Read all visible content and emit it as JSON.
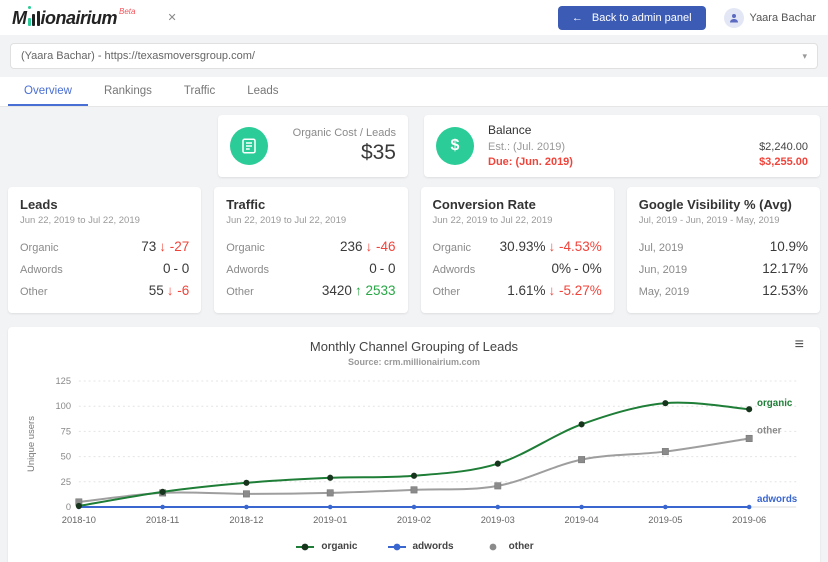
{
  "colors": {
    "accent_blue": "#3b5bb5",
    "tab_active_blue": "#4a6fd4",
    "icon_green": "#2bcc97",
    "negative_red": "#f0443b",
    "positive_green": "#28a745",
    "beta_red": "#f2545b"
  },
  "header": {
    "logo_prefix": "M",
    "logo_suffix": "ionairium",
    "logo_beta": "Beta",
    "back_button_label": "Back to admin panel",
    "user_name": "Yaara Bachar"
  },
  "icons": {
    "collapse": "✕",
    "back_arrow": "←",
    "caret_down": "▾",
    "menu": "≡",
    "dollar": "$"
  },
  "site_selector": {
    "value": "(Yaara Bachar) - https://texasmoversgroup.com/"
  },
  "tabs": [
    {
      "label": "Overview",
      "active": true
    },
    {
      "label": "Rankings",
      "active": false
    },
    {
      "label": "Traffic",
      "active": false
    },
    {
      "label": "Leads",
      "active": false
    }
  ],
  "summary": {
    "organic_cost": {
      "label": "Organic Cost / Leads",
      "value": "$35"
    },
    "balance": {
      "title": "Balance",
      "rows": [
        {
          "label": "Est.: (Jul. 2019)",
          "value": "$2,240.00",
          "color": "default"
        },
        {
          "label": "Due: (Jun. 2019)",
          "value": "$3,255.00",
          "color": "red"
        }
      ]
    }
  },
  "stat_cards": [
    {
      "title": "Leads",
      "subtitle": "Jun 22, 2019 to Jul 22, 2019",
      "rows": [
        {
          "label": "Organic",
          "value": "73",
          "delta": "↓ -27",
          "delta_color": "red"
        },
        {
          "label": "Adwords",
          "value": "0",
          "delta": "- 0",
          "delta_color": "neutral"
        },
        {
          "label": "Other",
          "value": "55",
          "delta": "↓ -6",
          "delta_color": "red"
        }
      ]
    },
    {
      "title": "Traffic",
      "subtitle": "Jun 22, 2019 to Jul 22, 2019",
      "rows": [
        {
          "label": "Organic",
          "value": "236",
          "delta": "↓ -46",
          "delta_color": "red"
        },
        {
          "label": "Adwords",
          "value": "0",
          "delta": "- 0",
          "delta_color": "neutral"
        },
        {
          "label": "Other",
          "value": "3420",
          "delta": "↑ 2533",
          "delta_color": "green"
        }
      ]
    },
    {
      "title": "Conversion Rate",
      "subtitle": "Jun 22, 2019 to Jul 22, 2019",
      "rows": [
        {
          "label": "Organic",
          "value": "30.93%",
          "delta": "↓ -4.53%",
          "delta_color": "red"
        },
        {
          "label": "Adwords",
          "value": "0%",
          "delta": "- 0%",
          "delta_color": "neutral"
        },
        {
          "label": "Other",
          "value": "1.61%",
          "delta": "↓ -5.27%",
          "delta_color": "red"
        }
      ]
    },
    {
      "title": "Google Visibility % (Avg)",
      "subtitle": "Jul, 2019 - Jun, 2019 - May, 2019",
      "rows": [
        {
          "label": "Jul, 2019",
          "value": "10.9%"
        },
        {
          "label": "Jun, 2019",
          "value": "12.17%"
        },
        {
          "label": "May, 2019",
          "value": "12.53%"
        }
      ]
    }
  ],
  "chart_data": {
    "type": "line",
    "title": "Monthly Channel Grouping of Leads",
    "subtitle": "Source: crm.millionairium.com",
    "ylabel": "Unique users",
    "xlabel": "",
    "ylim": [
      0,
      125
    ],
    "yticks": [
      0,
      25,
      50,
      75,
      100,
      125
    ],
    "grid": "horizontal-dotted",
    "legend_position": "bottom",
    "categories": [
      "2018-10",
      "2018-11",
      "2018-12",
      "2019-01",
      "2019-02",
      "2019-03",
      "2019-04",
      "2019-05",
      "2019-06"
    ],
    "series": [
      {
        "name": "organic",
        "color": "#1e7d36",
        "marker_color": "#17351d",
        "marker": "circle",
        "legend": "line-dot",
        "values": [
          1,
          15,
          24,
          29,
          31,
          43,
          82,
          103,
          97
        ]
      },
      {
        "name": "adwords",
        "color": "#3a66d0",
        "marker_color": "#3a66d0",
        "marker": "dot",
        "legend": "line-dot",
        "values": [
          0,
          0,
          0,
          0,
          0,
          0,
          0,
          0,
          0
        ]
      },
      {
        "name": "other",
        "color": "#9e9e9e",
        "marker_color": "#8b8b8b",
        "marker": "square",
        "legend": "dot",
        "values": [
          5,
          14,
          13,
          14,
          17,
          21,
          47,
          55,
          68
        ]
      }
    ]
  }
}
